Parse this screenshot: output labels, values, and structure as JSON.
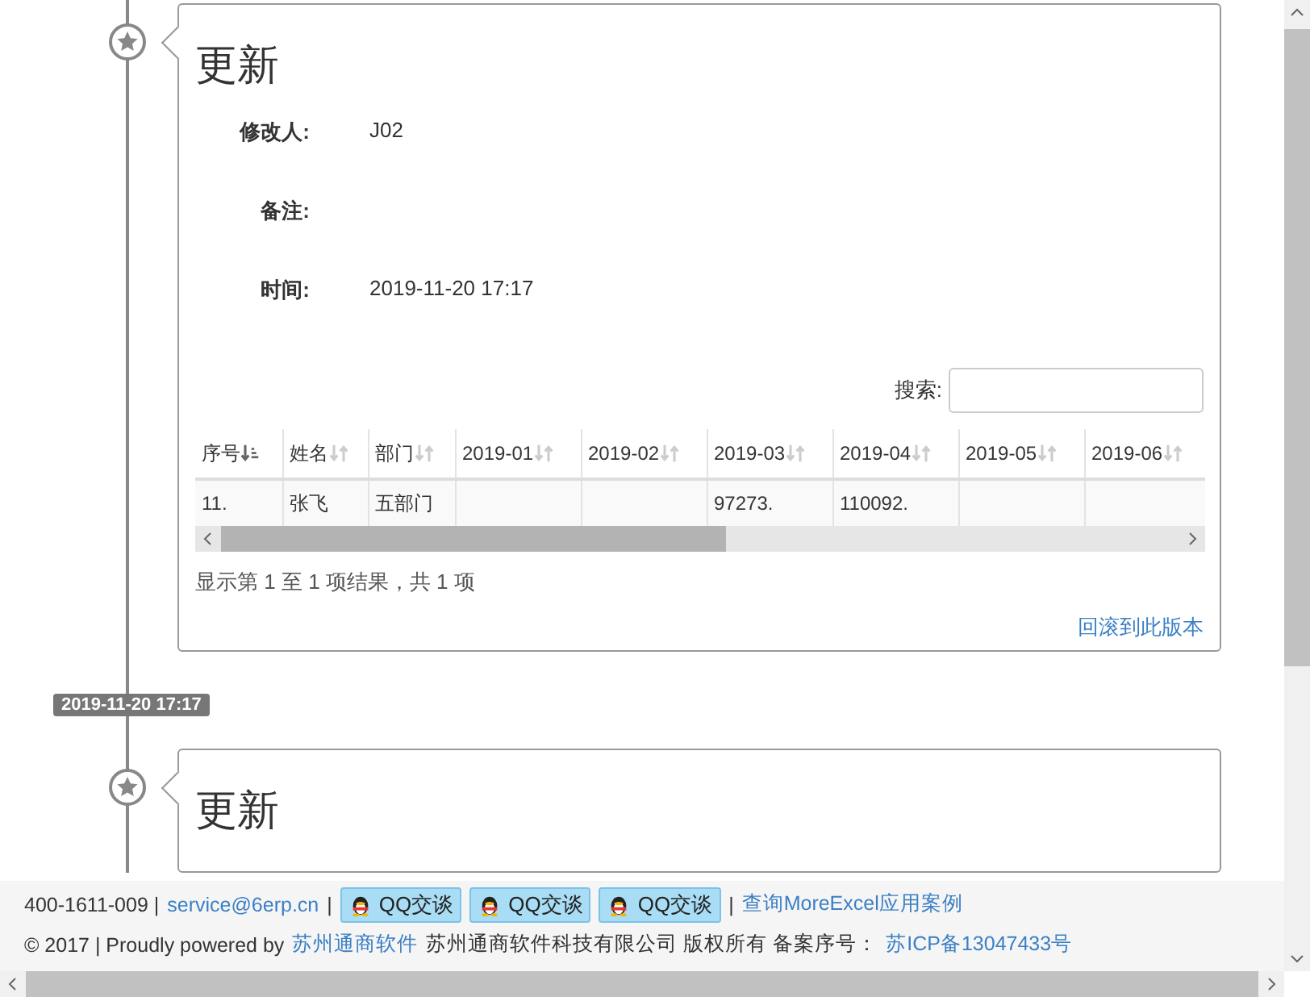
{
  "timeline": [
    {
      "kind": "entry",
      "title": "更新",
      "fields": [
        {
          "label": "修改人:",
          "value": "J02"
        },
        {
          "label": "备注:"
        },
        {
          "label": "时间:",
          "value": "2019-11-20 17:17"
        }
      ],
      "search": {
        "label": "搜索:"
      },
      "table": {
        "columns": [
          {
            "label": "序号",
            "sorted": true
          },
          {
            "label": "姓名",
            "sorted": false
          },
          {
            "label": "部门",
            "sorted": false
          },
          {
            "label": "2019-01",
            "sorted": false
          },
          {
            "label": "2019-02",
            "sorted": false
          },
          {
            "label": "2019-03",
            "sorted": false
          },
          {
            "label": "2019-04",
            "sorted": false
          },
          {
            "label": "2019-05",
            "sorted": false
          },
          {
            "label": "2019-06",
            "sorted": false
          }
        ],
        "rows": [
          [
            "11.",
            "张飞",
            "五部门",
            null,
            null,
            "97273.",
            "110092.",
            null,
            null
          ]
        ]
      },
      "info": "显示第 1 至 1 项结果，共 1 项",
      "action": "回滚到此版本"
    },
    {
      "kind": "date",
      "label": "2019-11-20 17:17"
    },
    {
      "kind": "entry",
      "title": "更新"
    }
  ],
  "footer": {
    "line1": [
      {
        "kind": "text",
        "text": "400-1611-009 |"
      },
      {
        "kind": "link",
        "text": "service@6erp.cn"
      },
      {
        "kind": "text",
        "text": "|"
      },
      {
        "kind": "qq",
        "text": "QQ交谈"
      },
      {
        "kind": "qq",
        "text": "QQ交谈"
      },
      {
        "kind": "qq",
        "text": "QQ交谈"
      },
      {
        "kind": "text",
        "text": "|"
      },
      {
        "kind": "link",
        "text": "查询MoreExcel应用案例"
      }
    ],
    "line2": [
      {
        "kind": "text",
        "text": "© 2017 | Proudly powered by"
      },
      {
        "kind": "link",
        "text": "苏州通商软件"
      },
      {
        "kind": "text",
        "text": "苏州通商软件科技有限公司 版权所有 备案序号："
      },
      {
        "kind": "link",
        "text": "苏ICP备13047433号"
      }
    ]
  }
}
